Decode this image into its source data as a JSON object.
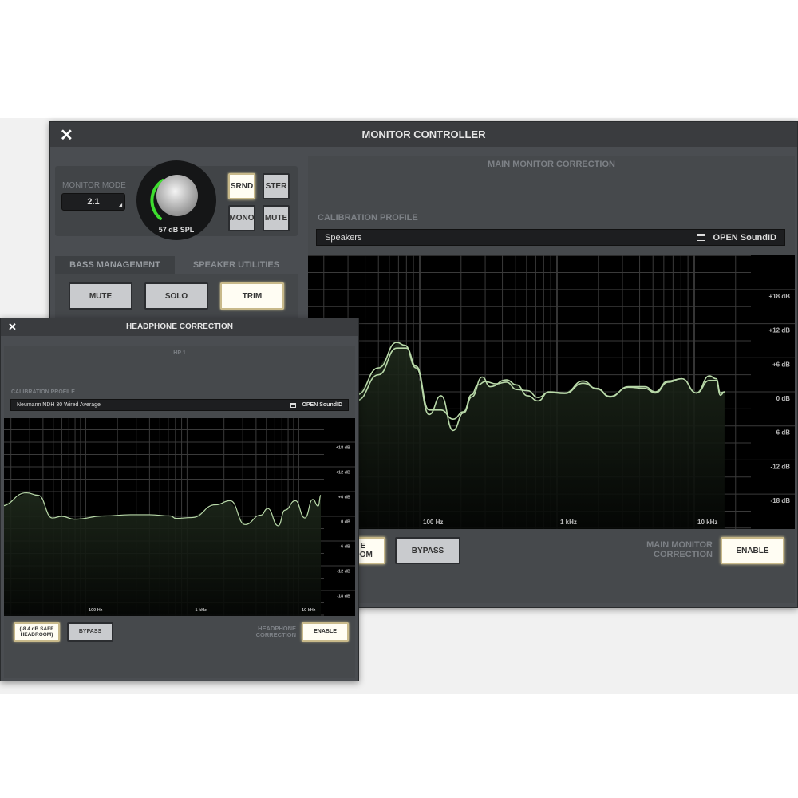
{
  "main_window": {
    "title": "MONITOR CONTROLLER",
    "monitor_mode": {
      "label": "MONITOR MODE",
      "value": "2.1"
    },
    "knob": {
      "readout": "57 dB SPL",
      "level_fraction": 0.3
    },
    "mode_buttons": [
      {
        "label": "SRND",
        "active": true
      },
      {
        "label": "STER",
        "active": false
      },
      {
        "label": "MONO",
        "active": false
      },
      {
        "label": "MUTE",
        "active": false
      }
    ],
    "tabs": [
      {
        "label": "BASS MANAGEMENT",
        "active": true
      },
      {
        "label": "SPEAKER UTILITIES",
        "active": false
      }
    ],
    "bass_buttons": [
      {
        "label": "MUTE",
        "active": false
      },
      {
        "label": "SOLO",
        "active": false
      },
      {
        "label": "TRIM",
        "active": true
      }
    ],
    "correction": {
      "section_title": "MAIN MONITOR CORRECTION",
      "profile_label": "CALIBRATION PROFILE",
      "profile_value": "Speakers",
      "open_label": "OPEN SoundID",
      "y_ticks": [
        "+18 dB",
        "+12 dB",
        "+6 dB",
        "0 dB",
        "-6 dB",
        "-12 dB",
        "-18 dB"
      ],
      "x_ticks": [
        "100 Hz",
        "1 kHz",
        "10 kHz"
      ],
      "headroom_label_partial": "E\nOOM",
      "bypass_label": "BYPASS",
      "enable_caption": "MAIN MONITOR\nCORRECTION",
      "enable_label": "ENABLE",
      "curves": [
        [
          [
            35,
            -0.5
          ],
          [
            50,
            4.2
          ],
          [
            68,
            8.7
          ],
          [
            78,
            8.2
          ],
          [
            94,
            4.2
          ],
          [
            117,
            -4.0
          ],
          [
            143,
            -0.7
          ],
          [
            175,
            -6.8
          ],
          [
            209,
            -3.7
          ],
          [
            239,
            -0.9
          ],
          [
            285,
            2.6
          ],
          [
            326,
            0.9
          ],
          [
            427,
            2.1
          ],
          [
            510,
            1.2
          ],
          [
            610,
            -0.7
          ],
          [
            728,
            -1.6
          ],
          [
            871,
            0
          ],
          [
            1138,
            -0.2
          ],
          [
            1550,
            1.9
          ],
          [
            1950,
            0.5
          ],
          [
            2430,
            -0.9
          ],
          [
            3320,
            0.9
          ],
          [
            4360,
            0.9
          ],
          [
            5190,
            0
          ],
          [
            6460,
            1.9
          ],
          [
            8120,
            2.3
          ],
          [
            10370,
            -0.2
          ],
          [
            12900,
            2.8
          ],
          [
            14460,
            2.3
          ],
          [
            15500,
            -0.2
          ],
          [
            16600,
            0
          ]
        ],
        [
          [
            35,
            -1.5
          ],
          [
            50,
            3
          ],
          [
            68,
            7.7
          ],
          [
            80,
            7.7
          ],
          [
            94,
            4.5
          ],
          [
            117,
            -3.2
          ],
          [
            143,
            -3.2
          ],
          [
            175,
            -4.8
          ],
          [
            209,
            -3.5
          ],
          [
            239,
            -0.5
          ],
          [
            265,
            1.2
          ],
          [
            300,
            1.8
          ],
          [
            360,
            1.4
          ],
          [
            427,
            1.7
          ],
          [
            510,
            0.4
          ],
          [
            610,
            0.2
          ],
          [
            728,
            -1.0
          ],
          [
            871,
            -0.1
          ],
          [
            1138,
            -0.3
          ],
          [
            1550,
            1.5
          ],
          [
            1950,
            0.6
          ],
          [
            2430,
            -0.8
          ],
          [
            3320,
            0.8
          ],
          [
            4360,
            0.6
          ],
          [
            5190,
            -0.2
          ],
          [
            6460,
            1.7
          ],
          [
            8120,
            2.3
          ],
          [
            10370,
            -0.2
          ],
          [
            12900,
            2.0
          ],
          [
            14460,
            2.0
          ],
          [
            15500,
            -0.6
          ],
          [
            16600,
            0
          ]
        ]
      ]
    }
  },
  "headphone_window": {
    "title": "HEADPHONE CORRECTION",
    "output_label": "HP 1",
    "profile_label": "CALIBRATION PROFILE",
    "profile_value": "Neumann NDH 30 Wired Average",
    "open_label": "OPEN SoundID",
    "y_ticks": [
      "+18 dB",
      "+12 dB",
      "+6 dB",
      "0 dB",
      "-6 dB",
      "-12 dB",
      "-18 dB"
    ],
    "x_ticks": [
      "100 Hz",
      "1 kHz",
      "10 kHz"
    ],
    "headroom_label": "(-8.4 dB SAFE\nHEADROOM)",
    "bypass_label": "BYPASS",
    "enable_caption": "HEADPHONE\nCORRECTION",
    "enable_label": "ENABLE",
    "curves": [
      [
        [
          16,
          2.5
        ],
        [
          28,
          5.7
        ],
        [
          36,
          5.1
        ],
        [
          49,
          -0.4
        ],
        [
          60,
          0
        ],
        [
          79,
          -0.7
        ],
        [
          150,
          0.1
        ],
        [
          266,
          0.4
        ],
        [
          398,
          0.4
        ],
        [
          630,
          0.1
        ],
        [
          706,
          -0.5
        ],
        [
          1000,
          -0.3
        ],
        [
          1670,
          2.8
        ],
        [
          2290,
          3.8
        ],
        [
          3150,
          -2.0
        ],
        [
          4450,
          0.3
        ],
        [
          5130,
          1.9
        ],
        [
          6460,
          -2.3
        ],
        [
          7460,
          1.5
        ],
        [
          9340,
          3.8
        ],
        [
          11480,
          -0.4
        ],
        [
          13650,
          4.1
        ],
        [
          15300,
          2.5
        ],
        [
          16220,
          5.1
        ]
      ]
    ]
  },
  "colors": {
    "curve": "#b8d8a8",
    "active_button": "#fffdf3",
    "knob_ring": "#3ddc2e",
    "panel": "#4a4d51"
  }
}
